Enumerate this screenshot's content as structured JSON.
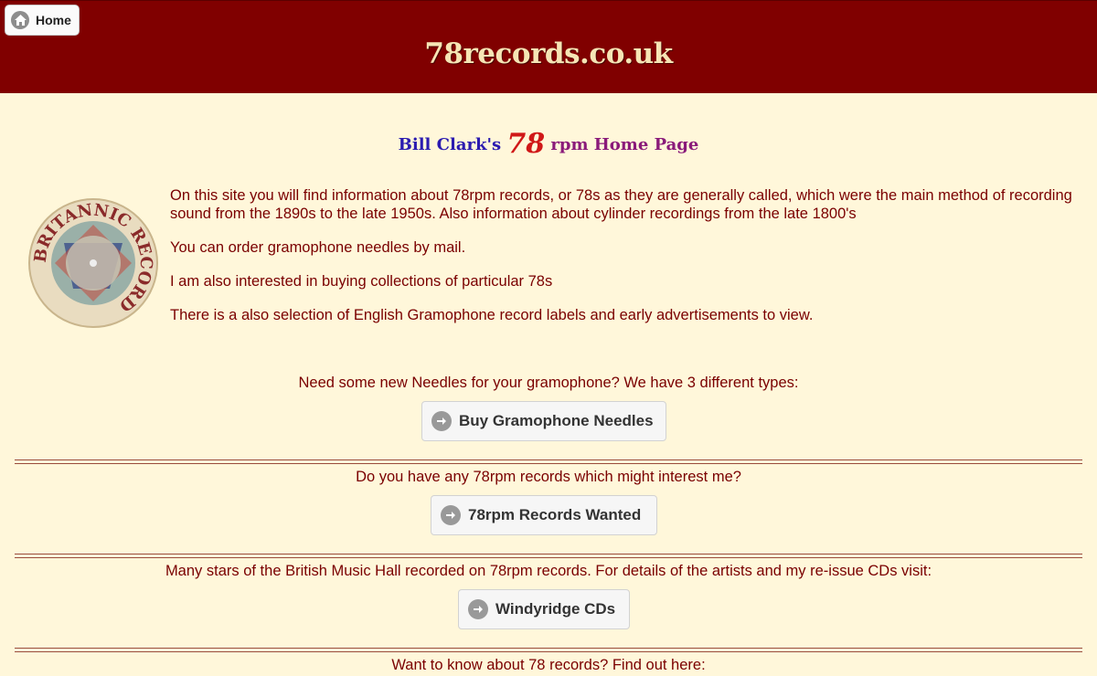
{
  "header": {
    "home_label": "Home",
    "site_title": "78records.co.uk"
  },
  "subtitle": {
    "part1": "Bill Clark's",
    "part2": "78",
    "part3": "rpm Home Page"
  },
  "logo": {
    "text": "BRITANNIC RECORD",
    "icon": "record-label-image"
  },
  "intro": [
    "On this site you will find information about 78rpm records, or 78s as they are generally called, which were the main method of recording sound from the 1890s to the late 1950s. Also information about cylinder recordings from the late 1800's",
    "You can order gramophone needles by mail.",
    "I am also interested in buying collections of particular 78s",
    "There is a also selection of English Gramophone record labels and early advertisements to view."
  ],
  "sections": [
    {
      "prompt": "Need some new Needles for your gramophone? We have 3 different types:",
      "button": "Buy Gramophone Needles"
    },
    {
      "prompt": "Do you have any 78rpm records which might interest me?",
      "button": "78rpm Records Wanted"
    },
    {
      "prompt": "Many stars of the British Music Hall recorded on 78rpm records. For details of the artists and my re-issue CDs visit:",
      "button": "Windyridge CDs"
    },
    {
      "prompt": "Want to know about 78 records? Find out here:"
    }
  ],
  "colors": {
    "header_bg": "#800000",
    "page_bg": "#fff7da",
    "text": "#7a0000"
  }
}
